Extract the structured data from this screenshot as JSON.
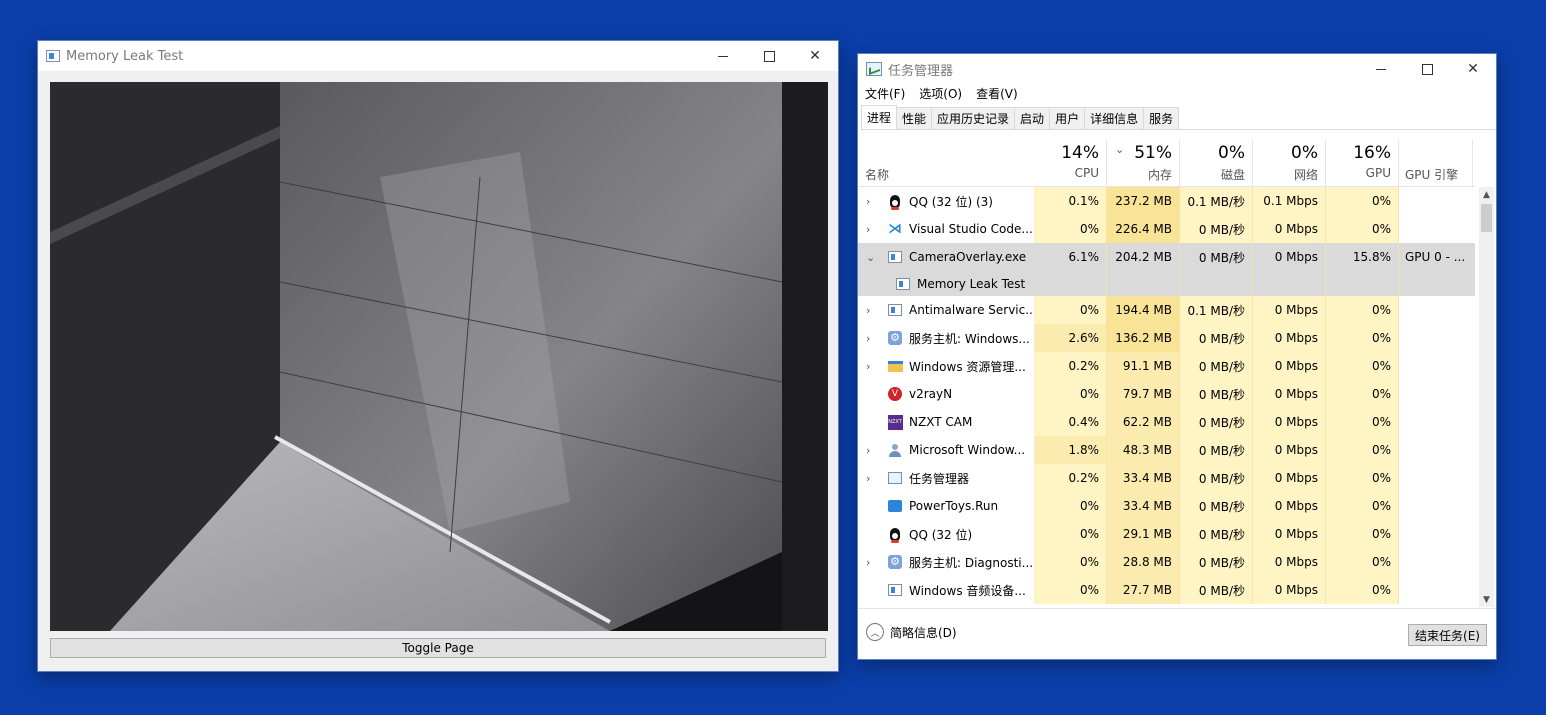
{
  "memory_window": {
    "title": "Memory Leak Test",
    "toggle_label": "Toggle Page"
  },
  "task_manager": {
    "title": "任务管理器",
    "menu": [
      "文件(F)",
      "选项(O)",
      "查看(V)"
    ],
    "tabs": [
      "进程",
      "性能",
      "应用历史记录",
      "启动",
      "用户",
      "详细信息",
      "服务"
    ],
    "active_tab": 0,
    "columns": {
      "name": "名称",
      "cpu": {
        "pct": "14%",
        "label": "CPU"
      },
      "mem": {
        "pct": "51%",
        "label": "内存"
      },
      "disk": {
        "pct": "0%",
        "label": "磁盘"
      },
      "net": {
        "pct": "0%",
        "label": "网络"
      },
      "gpu": {
        "pct": "16%",
        "label": "GPU"
      },
      "engine": {
        "label": "GPU 引擎"
      }
    },
    "rows": [
      {
        "name": "QQ (32 位) (3)",
        "icon": "penguin-icon",
        "expand": "›",
        "cpu": "0.1%",
        "mem": "237.2 MB",
        "disk": "0.1 MB/秒",
        "net": "0.1 Mbps",
        "gpu": "0%",
        "engine": "",
        "state": ""
      },
      {
        "name": "Visual Studio Code...",
        "icon": "vscode-icon",
        "expand": "›",
        "cpu": "0%",
        "mem": "226.4 MB",
        "disk": "0 MB/秒",
        "net": "0 Mbps",
        "gpu": "0%",
        "engine": "",
        "state": ""
      },
      {
        "name": "CameraOverlay.exe",
        "icon": "window-app-icon",
        "expand": "⌄",
        "cpu": "6.1%",
        "mem": "204.2 MB",
        "disk": "0 MB/秒",
        "net": "0 Mbps",
        "gpu": "15.8%",
        "engine": "GPU 0 - ...",
        "state": "sel"
      },
      {
        "name": "Memory Leak Test",
        "icon": "window-app-icon",
        "expand": "",
        "cpu": "",
        "mem": "",
        "disk": "",
        "net": "",
        "gpu": "",
        "engine": "",
        "state": "sub"
      },
      {
        "name": "Antimalware Servic...",
        "icon": "window-app-icon",
        "expand": "›",
        "cpu": "0%",
        "mem": "194.4 MB",
        "disk": "0.1 MB/秒",
        "net": "0 Mbps",
        "gpu": "0%",
        "engine": "",
        "state": ""
      },
      {
        "name": "服务主机: Windows...",
        "icon": "gear-icon",
        "expand": "›",
        "cpu": "2.6%",
        "mem": "136.2 MB",
        "disk": "0 MB/秒",
        "net": "0 Mbps",
        "gpu": "0%",
        "engine": "",
        "state": ""
      },
      {
        "name": "Windows 资源管理...",
        "icon": "folder-icon",
        "expand": "›",
        "cpu": "0.2%",
        "mem": "91.1 MB",
        "disk": "0 MB/秒",
        "net": "0 Mbps",
        "gpu": "0%",
        "engine": "",
        "state": ""
      },
      {
        "name": "v2rayN",
        "icon": "v2rayn-icon",
        "expand": "",
        "cpu": "0%",
        "mem": "79.7 MB",
        "disk": "0 MB/秒",
        "net": "0 Mbps",
        "gpu": "0%",
        "engine": "",
        "state": ""
      },
      {
        "name": "NZXT CAM",
        "icon": "nzxt-icon",
        "expand": "",
        "cpu": "0.4%",
        "mem": "62.2 MB",
        "disk": "0 MB/秒",
        "net": "0 Mbps",
        "gpu": "0%",
        "engine": "",
        "state": ""
      },
      {
        "name": "Microsoft Window...",
        "icon": "user-icon",
        "expand": "›",
        "cpu": "1.8%",
        "mem": "48.3 MB",
        "disk": "0 MB/秒",
        "net": "0 Mbps",
        "gpu": "0%",
        "engine": "",
        "state": ""
      },
      {
        "name": "任务管理器",
        "icon": "taskmgr-icon",
        "expand": "›",
        "cpu": "0.2%",
        "mem": "33.4 MB",
        "disk": "0 MB/秒",
        "net": "0 Mbps",
        "gpu": "0%",
        "engine": "",
        "state": ""
      },
      {
        "name": "PowerToys.Run",
        "icon": "powertoys-icon",
        "expand": "",
        "cpu": "0%",
        "mem": "33.4 MB",
        "disk": "0 MB/秒",
        "net": "0 Mbps",
        "gpu": "0%",
        "engine": "",
        "state": ""
      },
      {
        "name": "QQ (32 位)",
        "icon": "penguin-icon",
        "expand": "",
        "cpu": "0%",
        "mem": "29.1 MB",
        "disk": "0 MB/秒",
        "net": "0 Mbps",
        "gpu": "0%",
        "engine": "",
        "state": ""
      },
      {
        "name": "服务主机: Diagnosti...",
        "icon": "gear-icon",
        "expand": "›",
        "cpu": "0%",
        "mem": "28.8 MB",
        "disk": "0 MB/秒",
        "net": "0 Mbps",
        "gpu": "0%",
        "engine": "",
        "state": ""
      },
      {
        "name": "Windows 音频设备...",
        "icon": "window-app-icon",
        "expand": "",
        "cpu": "0%",
        "mem": "27.7 MB",
        "disk": "0 MB/秒",
        "net": "0 Mbps",
        "gpu": "0%",
        "engine": "",
        "state": ""
      }
    ],
    "fewer_details": "简略信息(D)",
    "end_task": "结束任务(E)",
    "heat_colors": {
      "low": "#fff4c4",
      "mid": "#fcebae",
      "high": "#f9e396"
    }
  }
}
